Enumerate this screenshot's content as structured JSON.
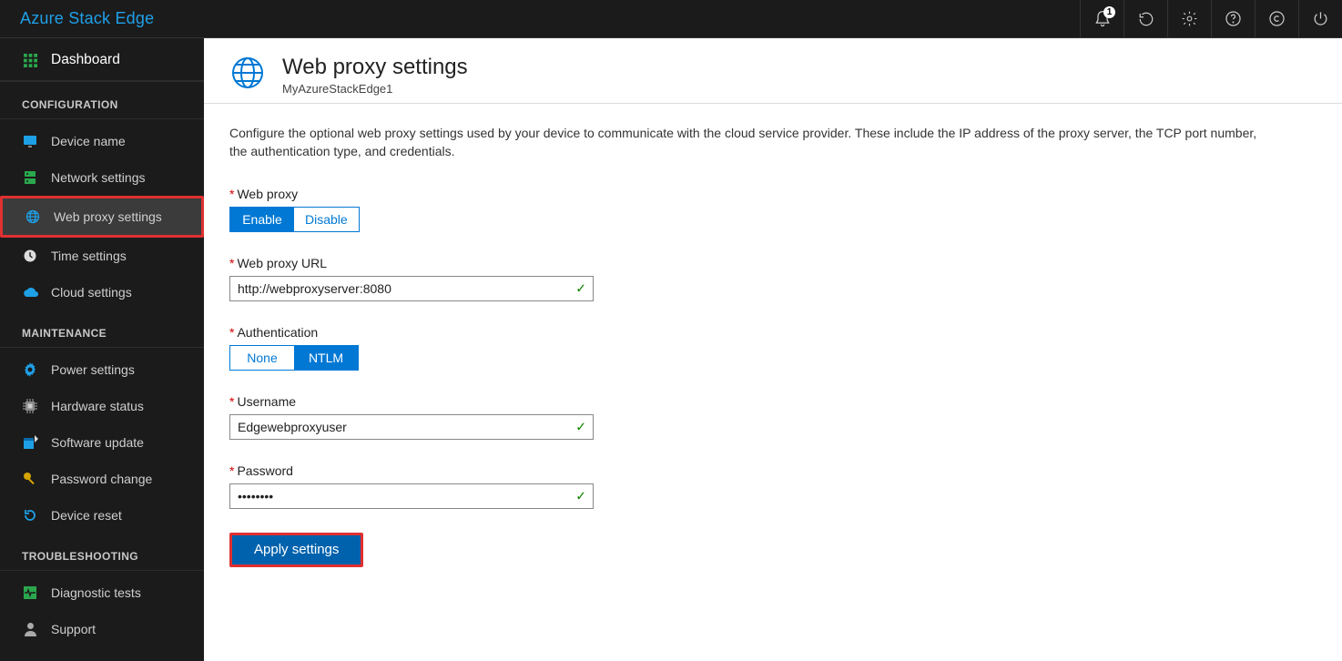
{
  "brand": "Azure Stack Edge",
  "notifications_count": "1",
  "sidebar": {
    "dashboard": "Dashboard",
    "sections": [
      {
        "heading": "CONFIGURATION",
        "items": [
          {
            "label": "Device name",
            "icon": "monitor",
            "active": false
          },
          {
            "label": "Network settings",
            "icon": "server",
            "active": false
          },
          {
            "label": "Web proxy settings",
            "icon": "globe",
            "active": true
          },
          {
            "label": "Time settings",
            "icon": "clock",
            "active": false
          },
          {
            "label": "Cloud settings",
            "icon": "cloud",
            "active": false
          }
        ]
      },
      {
        "heading": "MAINTENANCE",
        "items": [
          {
            "label": "Power settings",
            "icon": "gear",
            "active": false
          },
          {
            "label": "Hardware status",
            "icon": "chip",
            "active": false
          },
          {
            "label": "Software update",
            "icon": "update",
            "active": false
          },
          {
            "label": "Password change",
            "icon": "key",
            "active": false
          },
          {
            "label": "Device reset",
            "icon": "refresh",
            "active": false
          }
        ]
      },
      {
        "heading": "TROUBLESHOOTING",
        "items": [
          {
            "label": "Diagnostic tests",
            "icon": "diag",
            "active": false
          },
          {
            "label": "Support",
            "icon": "person",
            "active": false
          }
        ]
      }
    ]
  },
  "page": {
    "title": "Web proxy settings",
    "subtitle": "MyAzureStackEdge1",
    "description": "Configure the optional web proxy settings used by your device to communicate with the cloud service provider. These include the IP address of the proxy server, the TCP port number, the authentication type, and credentials."
  },
  "form": {
    "web_proxy_label": "Web proxy",
    "enable": "Enable",
    "disable": "Disable",
    "url_label": "Web proxy URL",
    "url_value": "http://webproxyserver:8080",
    "auth_label": "Authentication",
    "auth_none": "None",
    "auth_ntlm": "NTLM",
    "username_label": "Username",
    "username_value": "Edgewebproxyuser",
    "password_label": "Password",
    "password_value": "••••••••",
    "apply": "Apply settings"
  }
}
